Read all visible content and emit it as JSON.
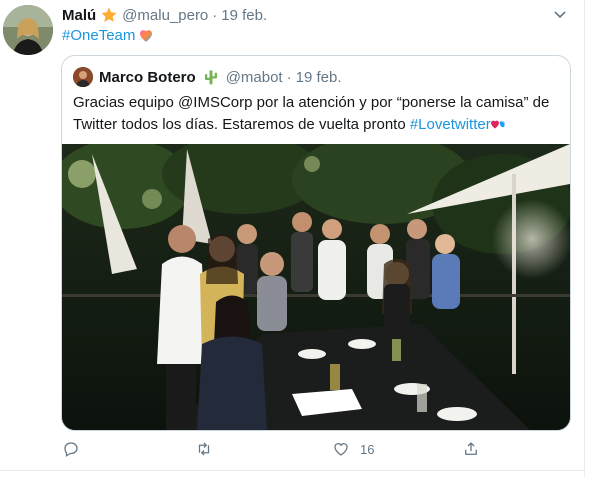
{
  "tweet": {
    "author_name": "Malú",
    "author_handle": "@malu_pero",
    "date": "19 feb.",
    "hashtag": "#OneTeam",
    "star_icon": "star-emoji",
    "heart_icon": "heart-emoji"
  },
  "quote": {
    "author_name": "Marco Botero",
    "author_handle": "@mabot",
    "date": "19 feb.",
    "badge_icon": "cactus-emoji",
    "text_part1": "Gracias equipo @IMSCorp por la atención y por “ponerse la camisa” de Twitter todos los días. Estaremos de vuelta pronto ",
    "text_link": "#Lovetwitter",
    "photo_description_icon": "group-photo"
  },
  "actions": {
    "reply_count": "",
    "retweet_count": "",
    "like_count": "16",
    "share_count": ""
  },
  "colors": {
    "link": "#1b95e0",
    "secondary_text": "#657786",
    "border": "#ccd6dd"
  }
}
